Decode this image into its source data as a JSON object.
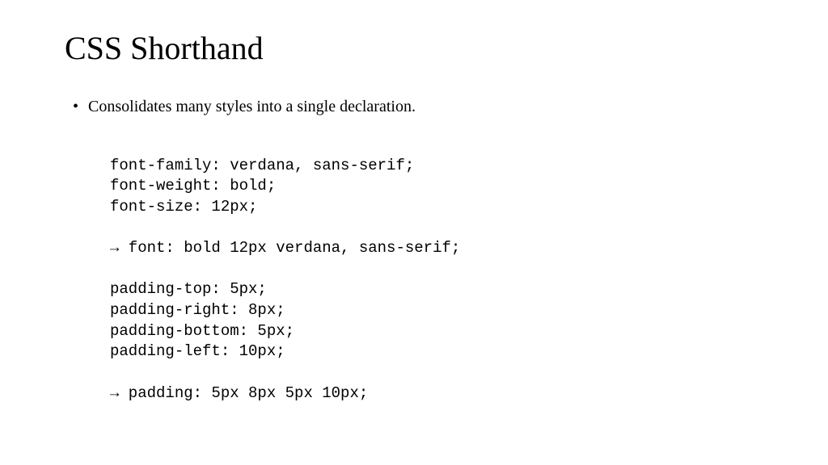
{
  "title": "CSS Shorthand",
  "bullet": {
    "marker": "•",
    "text": "Consolidates many styles into a single declaration."
  },
  "code": {
    "line1": "font-family: verdana, sans-serif;",
    "line2": "font-weight: bold;",
    "line3": "font-size: 12px;",
    "blank1": "",
    "line4": "→ font: bold 12px verdana, sans-serif;",
    "blank2": "",
    "line5": "padding-top: 5px;",
    "line6": "padding-right: 8px;",
    "line7": "padding-bottom: 5px;",
    "line8": "padding-left: 10px;",
    "blank3": "",
    "line9": "→ padding: 5px 8px 5px 10px;"
  }
}
